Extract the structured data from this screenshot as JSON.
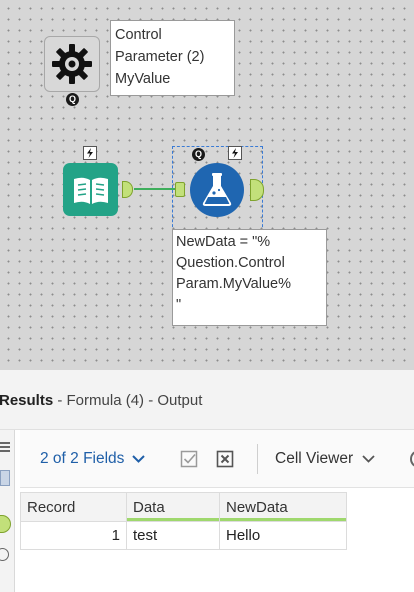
{
  "canvas": {
    "control_param_annotation": "Control\nParameter (2)\nMyValue",
    "formula_annotation": "NewData = \"%\nQuestion.Control\nParam.MyValue%\n\"",
    "q_badge_text": "Q"
  },
  "results": {
    "title_bold": "Results",
    "title_rest": " - Formula (4) - Output",
    "fields_label": "2 of 2 Fields",
    "viewer_label": "Cell Viewer",
    "columns": [
      "Record",
      "Data",
      "NewData"
    ],
    "rows": [
      {
        "record": "1",
        "data": "test",
        "newdata": "Hello"
      }
    ]
  },
  "colors": {
    "accent": "#1f5fa8",
    "input_tool": "#23a387",
    "formula_tool": "#1f66b1",
    "connector": "#3fae5c"
  }
}
